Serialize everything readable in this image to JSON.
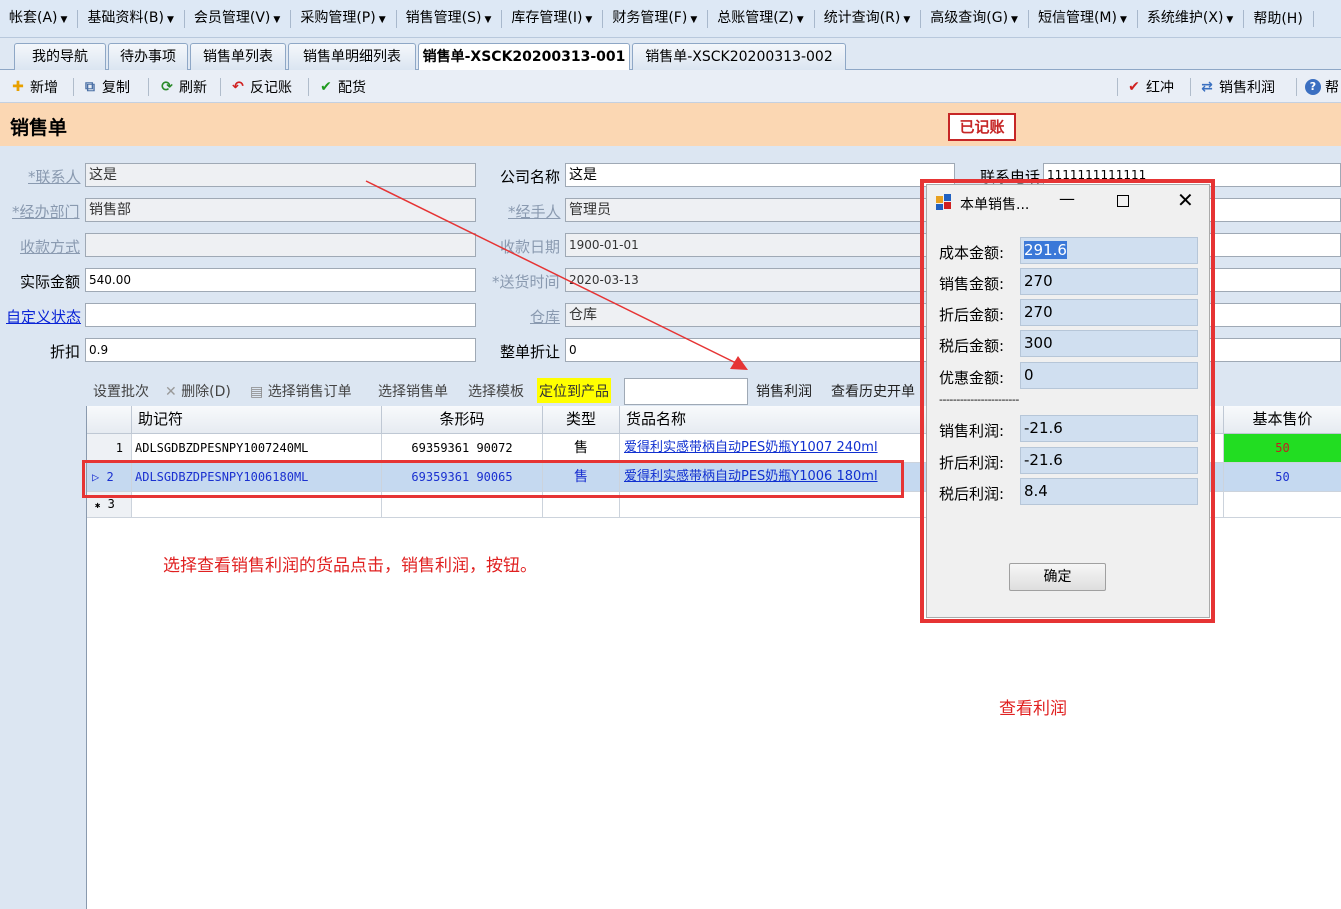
{
  "menu": [
    {
      "label": "帐套(A)"
    },
    {
      "label": "基础资料(B)"
    },
    {
      "label": "会员管理(V)"
    },
    {
      "label": "采购管理(P)"
    },
    {
      "label": "销售管理(S)"
    },
    {
      "label": "库存管理(I)"
    },
    {
      "label": "财务管理(F)"
    },
    {
      "label": "总账管理(Z)"
    },
    {
      "label": "统计查询(R)"
    },
    {
      "label": "高级查询(G)"
    },
    {
      "label": "短信管理(M)"
    },
    {
      "label": "系统维护(X)"
    },
    {
      "label": "帮助(H)"
    }
  ],
  "tabs": [
    "我的导航",
    "待办事项",
    "销售单列表",
    "销售单明细列表",
    "销售单-XSCK20200313-001",
    "销售单-XSCK20200313-002"
  ],
  "toolbar": {
    "new": "新增",
    "copy": "复制",
    "refresh": "刷新",
    "unpost": "反记账",
    "allocate": "配货",
    "redflush": "红冲",
    "profit": "销售利润",
    "help": "帮"
  },
  "page": {
    "title": "销售单",
    "stamp": "已记账"
  },
  "form": {
    "contact_label": "*联系人",
    "contact_value": "这是",
    "company_label": "公司名称",
    "company_value": "这是",
    "phone_label": "联系电话",
    "phone_value": "1111111111111",
    "dept_label": "*经办部门",
    "dept_value": "销售部",
    "handler_label": "*经手人",
    "handler_value": "管理员",
    "paymethod_label": "收款方式",
    "paymethod_value": "",
    "paydate_label": "收款日期",
    "paydate_value": "1900-01-01",
    "actual_label": "实际金额",
    "actual_value": "540.00",
    "deliver_label": "*送货时间",
    "deliver_value": "2020-03-13",
    "custom_label": "自定义状态",
    "custom_value": "",
    "warehouse_label": "仓库",
    "warehouse_value": "仓库",
    "discount_label": "折扣",
    "discount_value": "0.9",
    "wholediscount_label": "整单折让",
    "wholediscount_value": "0"
  },
  "gridtools": {
    "batch": "设置批次",
    "delete": "删除(D)",
    "select_order": "选择销售订单",
    "select_sale": "选择销售单",
    "select_template": "选择模板",
    "locate": "定位到产品",
    "locate_value": "",
    "profit": "销售利润",
    "history": "查看历史开单"
  },
  "grid": {
    "columns": [
      "助记符",
      "条形码",
      "类型",
      "货品名称",
      "基本售价"
    ],
    "rows": [
      {
        "no": "1",
        "code": "ADLSGDBZDPESNPY1007240ML",
        "barcode": "69359361 90072",
        "type": "售",
        "name": "爱得利实感带柄自动PES奶瓶Y1007 240ml",
        "price": "50"
      },
      {
        "no": "2",
        "code": "ADLSGDBZDPESNPY1006180ML",
        "barcode": "69359361 90065",
        "type": "售",
        "name": "爱得利实感带柄自动PES奶瓶Y1006 180ml",
        "price": "50"
      }
    ],
    "new_row_no": "3"
  },
  "annotations": {
    "note1": "选择查看销售利润的货品点击，销售利润，按钮。",
    "note2": "查看利润"
  },
  "dialog": {
    "title": "本单销售...",
    "cost_label": "成本金额:",
    "cost": "291.6",
    "sales_label": "销售金额:",
    "sales": "270",
    "discounted_label": "折后金额:",
    "discounted": "270",
    "aftertax_label": "税后金额:",
    "aftertax": "300",
    "promo_label": "优惠金额:",
    "promo": "0",
    "separator": "-----------------------",
    "profit_label": "销售利润:",
    "profit": "-21.6",
    "disc_profit_label": "折后利润:",
    "disc_profit": "-21.6",
    "tax_profit_label": "税后利润:",
    "tax_profit": "8.4",
    "ok": "确定"
  },
  "colors": {
    "highlight_red": "#e63434",
    "title_bg": "#fbd7b3",
    "form_bg": "#dce6f2",
    "green_cell": "#22dd22"
  }
}
